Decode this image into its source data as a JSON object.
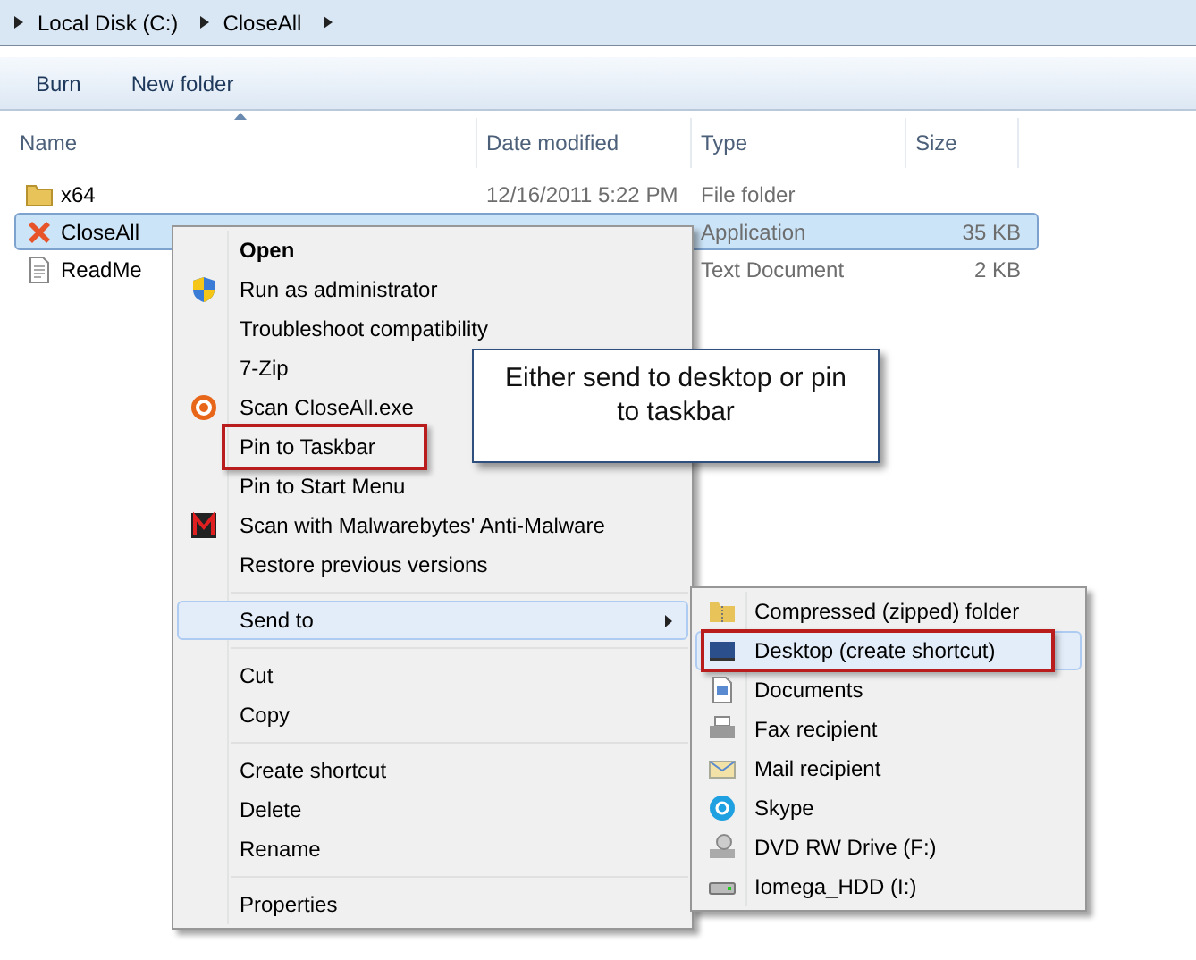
{
  "breadcrumb": [
    "Local Disk (C:)",
    "CloseAll"
  ],
  "toolbar": [
    "Burn",
    "New folder"
  ],
  "columns": [
    "Name",
    "Date modified",
    "Type",
    "Size"
  ],
  "files": [
    {
      "name": "x64",
      "date": "12/16/2011 5:22 PM",
      "type": "File folder",
      "selected": false
    },
    {
      "name": "CloseAll",
      "type": "Application",
      "size": "35 KB",
      "selected": true
    },
    {
      "name": "ReadMe",
      "type": "Text Document",
      "size": "2 KB",
      "selected": false
    }
  ],
  "context_menu": {
    "items": [
      {
        "kind": "item",
        "label": "Open",
        "bold": true,
        "selected": false,
        "marked": false
      },
      {
        "kind": "item",
        "label": "Run as administrator",
        "selected": false,
        "marked": false
      },
      {
        "kind": "item",
        "label": "Troubleshoot compatibility",
        "selected": false,
        "marked": false
      },
      {
        "kind": "item",
        "label": "7-Zip",
        "selected": false,
        "marked": false
      },
      {
        "kind": "item",
        "label": "Scan CloseAll.exe",
        "selected": false,
        "marked": false
      },
      {
        "kind": "item",
        "label": "Pin to Taskbar",
        "selected": false,
        "marked": true
      },
      {
        "kind": "item",
        "label": "Pin to Start Menu",
        "selected": false,
        "marked": false
      },
      {
        "kind": "item",
        "label": "Scan with Malwarebytes' Anti-Malware",
        "selected": false,
        "marked": false
      },
      {
        "kind": "item",
        "label": "Restore previous versions",
        "selected": false,
        "marked": false
      },
      {
        "kind": "separator"
      },
      {
        "kind": "submenu",
        "label": "Send to",
        "selected": true,
        "marked": false
      },
      {
        "kind": "separator"
      },
      {
        "kind": "item",
        "label": "Cut",
        "selected": false,
        "marked": false
      },
      {
        "kind": "item",
        "label": "Copy",
        "selected": false,
        "marked": false
      },
      {
        "kind": "separator"
      },
      {
        "kind": "item",
        "label": "Create shortcut",
        "selected": false,
        "marked": false
      },
      {
        "kind": "item",
        "label": "Delete",
        "selected": false,
        "marked": false
      },
      {
        "kind": "item",
        "label": "Rename",
        "selected": false,
        "marked": false
      },
      {
        "kind": "separator"
      },
      {
        "kind": "item",
        "label": "Properties",
        "selected": false,
        "marked": false
      }
    ]
  },
  "send_to_menu": {
    "items": [
      {
        "label": "Compressed (zipped) folder",
        "selected": false,
        "marked": false
      },
      {
        "label": "Desktop (create shortcut)",
        "selected": true,
        "marked": true
      },
      {
        "label": "Documents",
        "selected": false,
        "marked": false
      },
      {
        "label": "Fax recipient",
        "selected": false,
        "marked": false
      },
      {
        "label": "Mail recipient",
        "selected": false,
        "marked": false
      },
      {
        "label": "Skype",
        "selected": false,
        "marked": false
      },
      {
        "label": "DVD RW Drive (F:)",
        "selected": false,
        "marked": false
      },
      {
        "label": "Iomega_HDD (I:)",
        "selected": false,
        "marked": false
      }
    ]
  },
  "callout": {
    "text": "Either send to desktop or pin to taskbar"
  }
}
